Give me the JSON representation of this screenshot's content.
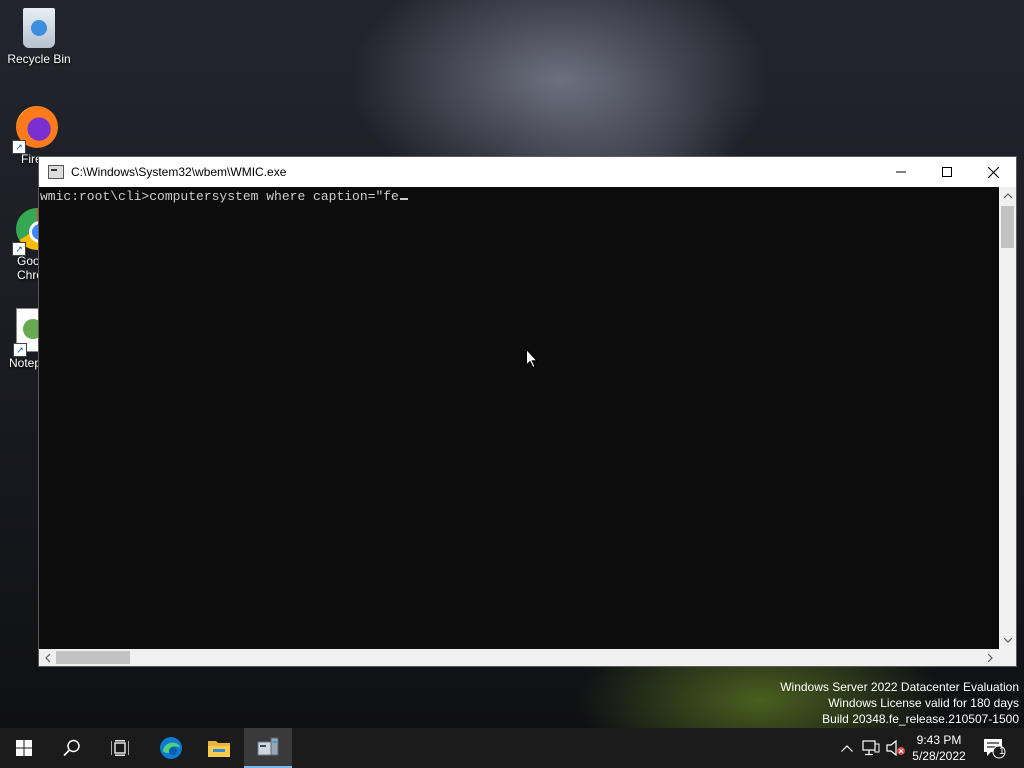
{
  "desktop": {
    "icons": [
      {
        "label": "Recycle Bin",
        "icon": "recycle-bin-icon"
      },
      {
        "label": "Fire",
        "icon": "firefox-icon"
      },
      {
        "label": "Goo Chro",
        "icon": "chrome-icon"
      },
      {
        "label": "Notep",
        "icon": "notepad-icon"
      }
    ]
  },
  "window": {
    "title": "C:\\Windows\\System32\\wbem\\WMIC.exe",
    "icon": "console-icon",
    "console_text": "wmic:root\\cli>computersystem where caption=\"fe",
    "background": "#0c0c0c",
    "text_color": "#cccccc"
  },
  "watermark": {
    "line1": "Windows Server 2022 Datacenter Evaluation",
    "line2": "Windows License valid for 180 days",
    "line3": "Build 20348.fe_release.210507-1500"
  },
  "taskbar": {
    "items": [
      "start-icon",
      "search-icon",
      "task-view-icon",
      "edge-icon",
      "file-explorer-icon",
      "wmic-icon"
    ],
    "active": "wmic-icon",
    "clock_time": "9:43 PM",
    "clock_date": "5/28/2022",
    "notification_count": "1",
    "accent": "#76b9ed"
  }
}
